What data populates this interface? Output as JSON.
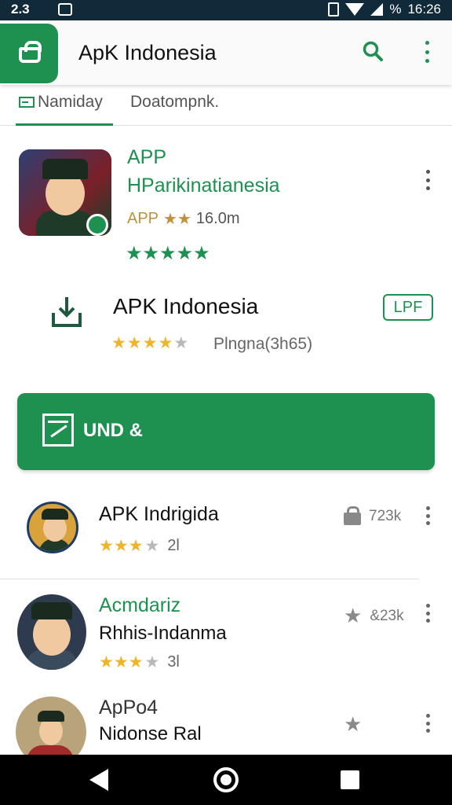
{
  "status_bar": {
    "left_text": "2.3",
    "time": "16:26",
    "battery": "%"
  },
  "app_bar": {
    "title": "ApK Indonesia",
    "icons": [
      "shopping-bag-icon",
      "search-icon",
      "more-vert-icon"
    ]
  },
  "tabs": [
    {
      "label": "Namiday"
    },
    {
      "label": "Doatompnk."
    }
  ],
  "featured": {
    "title_line1": "APP",
    "title_line2": "HParikinatianesia",
    "meta_prefix": "APP",
    "meta_stars": "★★",
    "meta_size": "16.0m",
    "rating_stars": "★★★★★"
  },
  "download_row": {
    "title": "APK Indonesia",
    "stars_gold": "★★★★",
    "stars_gray": "★",
    "subtitle": "Plngna(3h65)",
    "chip": "LPF"
  },
  "primary_button": {
    "label": "UND &"
  },
  "list": [
    {
      "title": "APK Indrigida",
      "subtitle": "",
      "stars_gold": "★★★",
      "stars_gray": "★",
      "rating_num": "2l",
      "right_count": "723k",
      "right_icon": "lock-icon"
    },
    {
      "title": "Acmdariz",
      "subtitle": "Rhhis-Indanma",
      "stars_gold": "★★★",
      "stars_gray": "★",
      "rating_num": "3l",
      "right_count": "&23k",
      "right_icon": "star-icon"
    },
    {
      "title": "ApPo4",
      "subtitle": "Nidonse Ral",
      "stars_gold": "",
      "stars_gray": "",
      "rating_num": "",
      "right_count": "",
      "right_icon": "star-icon"
    }
  ],
  "colors": {
    "accent": "#1e9150",
    "star": "#f0b429",
    "status_bar": "#102a3a"
  }
}
